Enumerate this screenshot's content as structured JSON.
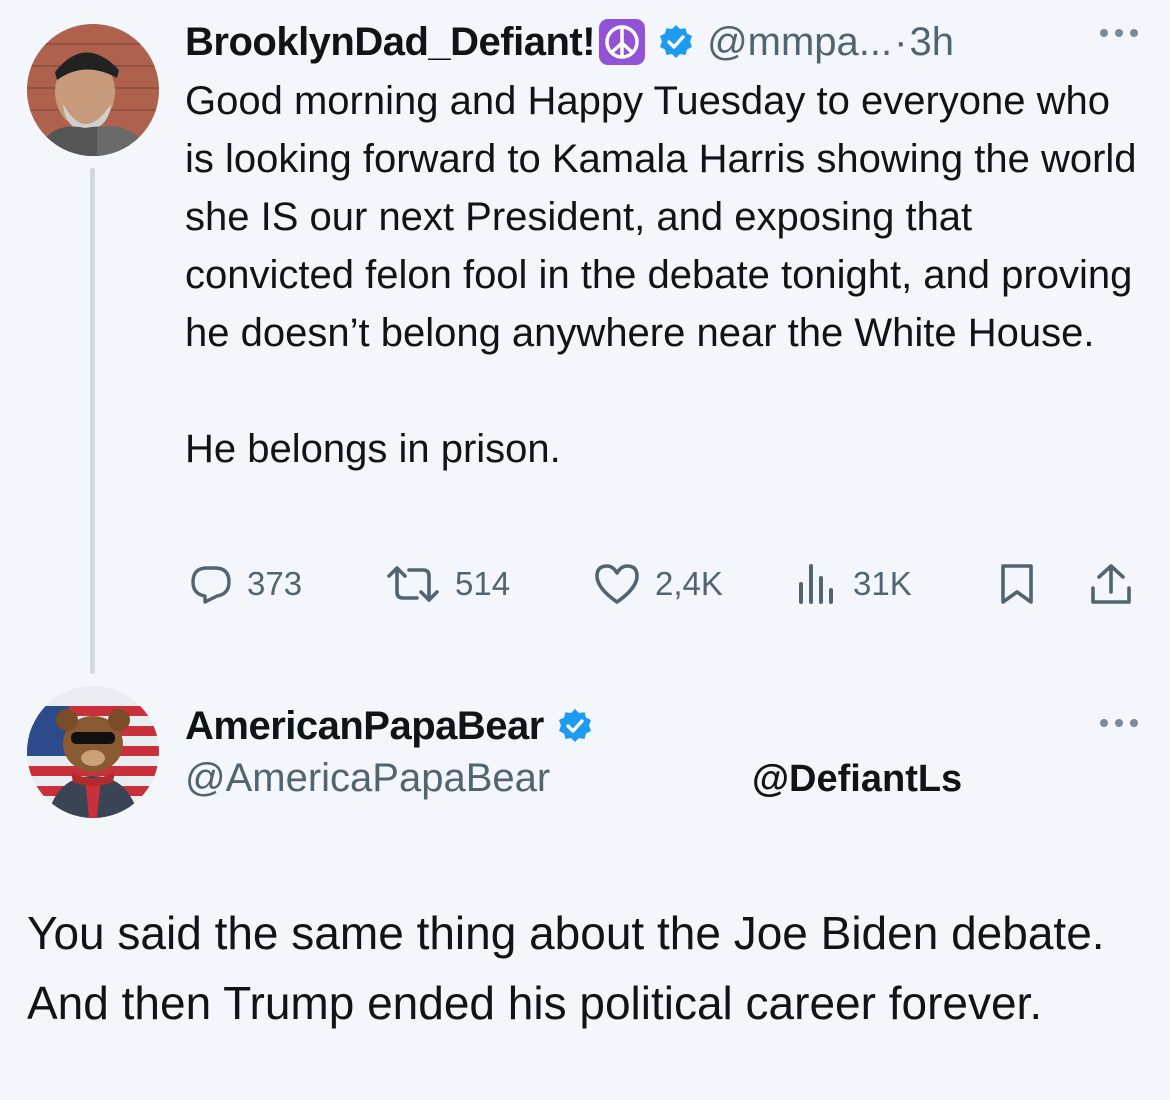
{
  "tweet1": {
    "display_name": "BrooklynDad_Defiant!",
    "handle": "@mmpa...",
    "separator": "·",
    "time": "3h",
    "text": "Good morning and Happy Tuesday to everyone who is looking forward to Kamala Harris showing the world she IS our next President, and exposing that convicted felon fool in the debate tonight, and proving he doesn’t belong anywhere near the White House.\n\nHe belongs in prison.",
    "stats": {
      "replies": "373",
      "reposts": "514",
      "likes": "2,4K",
      "views": "31K"
    },
    "icons": {
      "avatar": "avatar-photo",
      "emoji": "peace-symbol-icon",
      "verified": "verified-badge-icon",
      "more": "more-options-icon",
      "reply": "reply-icon",
      "repost": "repost-icon",
      "like": "heart-icon",
      "views": "views-chart-icon",
      "bookmark": "bookmark-icon",
      "share": "share-icon"
    }
  },
  "tweet2": {
    "display_name": "AmericanPapaBear",
    "handle": "@AmericaPapaBear",
    "mention": "@DefiantLs",
    "text": "You said the same thing about the Joe Biden debate. And then Trump ended his political career forever."
  },
  "colors": {
    "background": "#f3f6fb",
    "text": "#0f1419",
    "secondary": "#536471",
    "verified": "#1d9bf0",
    "thread_line": "#cfd9de",
    "emoji_purple": "#9152d8"
  }
}
